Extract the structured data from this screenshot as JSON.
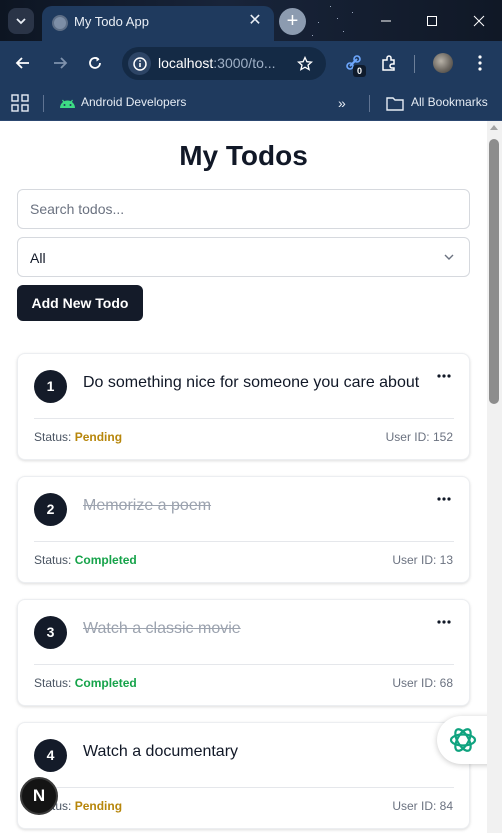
{
  "browser": {
    "tab_title": "My Todo App",
    "url_host": "localhost",
    "url_rest": ":3000/to...",
    "extension_badge": "0",
    "bookmarks": [
      {
        "label": "Android Developers"
      },
      {
        "label": "All Bookmarks"
      }
    ],
    "bookmarks_more": "»"
  },
  "page": {
    "title": "My Todos",
    "search_placeholder": "Search todos...",
    "filter_value": "All",
    "add_button": "Add New Todo"
  },
  "todos": [
    {
      "number": "1",
      "title": "Do something nice for someone you care about",
      "status_label": "Status:",
      "status": "Pending",
      "user": "User ID: 152",
      "completed": false
    },
    {
      "number": "2",
      "title": "Memorize a poem",
      "status_label": "Status:",
      "status": "Completed",
      "user": "User ID: 13",
      "completed": true
    },
    {
      "number": "3",
      "title": "Watch a classic movie",
      "status_label": "Status:",
      "status": "Completed",
      "user": "User ID: 68",
      "completed": true
    },
    {
      "number": "4",
      "title": "Watch a documentary",
      "status_label": "Status:",
      "status": "Pending",
      "user": "User ID: 84",
      "completed": false
    }
  ],
  "next_badge": "N",
  "colors": {
    "browser_chrome": "#1f3a5e",
    "primary_button": "#141b29",
    "status_pending": "#b7860b",
    "status_completed": "#16a34a",
    "widget_accent": "#10a37f"
  }
}
